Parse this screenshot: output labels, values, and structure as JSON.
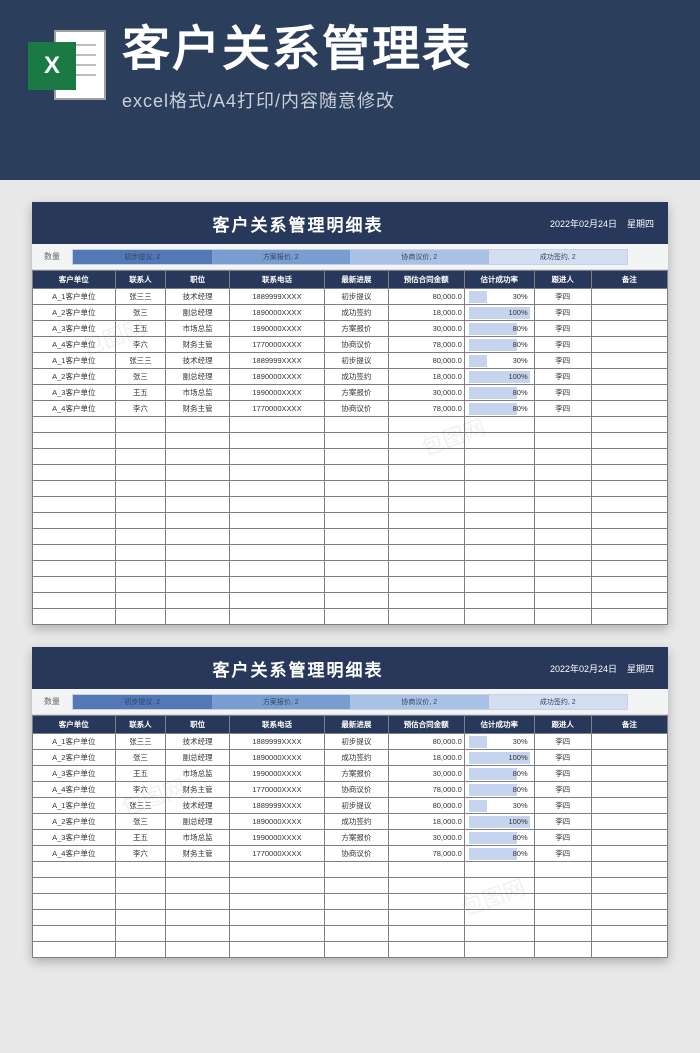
{
  "banner": {
    "title": "客户关系管理表",
    "subtitle": "excel格式/A4打印/内容随意修改",
    "icon_letter": "X"
  },
  "sheet": {
    "title": "客户关系管理明细表",
    "date": "2022年02月24日",
    "weekday": "星期四",
    "summary_label": "数量",
    "segments": [
      {
        "label": "初步提议, 2",
        "color": "#5278b7"
      },
      {
        "label": "方案报价, 2",
        "color": "#7a9dd1"
      },
      {
        "label": "协商议价, 2",
        "color": "#a9c1e4"
      },
      {
        "label": "成功签约, 2",
        "color": "#d3def0"
      }
    ],
    "headers": [
      "客户单位",
      "联系人",
      "职位",
      "联系电话",
      "最新进展",
      "预估合同金额",
      "估计成功率",
      "跟进人",
      "备注"
    ],
    "rows": [
      {
        "unit": "A_1客户单位",
        "contact": "张三三",
        "role": "技术经理",
        "phone": "1889999XXXX",
        "stage": "初步提议",
        "amount": "80,000.0",
        "rate": 30,
        "follower": "李四",
        "note": ""
      },
      {
        "unit": "A_2客户单位",
        "contact": "张三",
        "role": "副总经理",
        "phone": "1890000XXXX",
        "stage": "成功签约",
        "amount": "18,000.0",
        "rate": 100,
        "follower": "李四",
        "note": ""
      },
      {
        "unit": "A_3客户单位",
        "contact": "王五",
        "role": "市场总监",
        "phone": "1990000XXXX",
        "stage": "方案报价",
        "amount": "30,000.0",
        "rate": 80,
        "follower": "李四",
        "note": ""
      },
      {
        "unit": "A_4客户单位",
        "contact": "李六",
        "role": "财务主管",
        "phone": "1770000XXXX",
        "stage": "协商议价",
        "amount": "78,000.0",
        "rate": 80,
        "follower": "李四",
        "note": ""
      },
      {
        "unit": "A_1客户单位",
        "contact": "张三三",
        "role": "技术经理",
        "phone": "1889999XXXX",
        "stage": "初步提议",
        "amount": "80,000.0",
        "rate": 30,
        "follower": "李四",
        "note": ""
      },
      {
        "unit": "A_2客户单位",
        "contact": "张三",
        "role": "副总经理",
        "phone": "1890000XXXX",
        "stage": "成功签约",
        "amount": "18,000.0",
        "rate": 100,
        "follower": "李四",
        "note": ""
      },
      {
        "unit": "A_3客户单位",
        "contact": "王五",
        "role": "市场总监",
        "phone": "1990000XXXX",
        "stage": "方案报价",
        "amount": "30,000.0",
        "rate": 80,
        "follower": "李四",
        "note": ""
      },
      {
        "unit": "A_4客户单位",
        "contact": "李六",
        "role": "财务主管",
        "phone": "1770000XXXX",
        "stage": "协商议价",
        "amount": "78,000.0",
        "rate": 80,
        "follower": "李四",
        "note": ""
      }
    ],
    "blank_rows_top": 13,
    "blank_rows_bottom": 6
  },
  "chart_data": {
    "type": "bar",
    "title": "阶段数量",
    "categories": [
      "初步提议",
      "方案报价",
      "协商议价",
      "成功签约"
    ],
    "values": [
      2,
      2,
      2,
      2
    ],
    "xlabel": "",
    "ylabel": "数量",
    "ylim": [
      0,
      2
    ]
  },
  "watermark_text": "包图网"
}
